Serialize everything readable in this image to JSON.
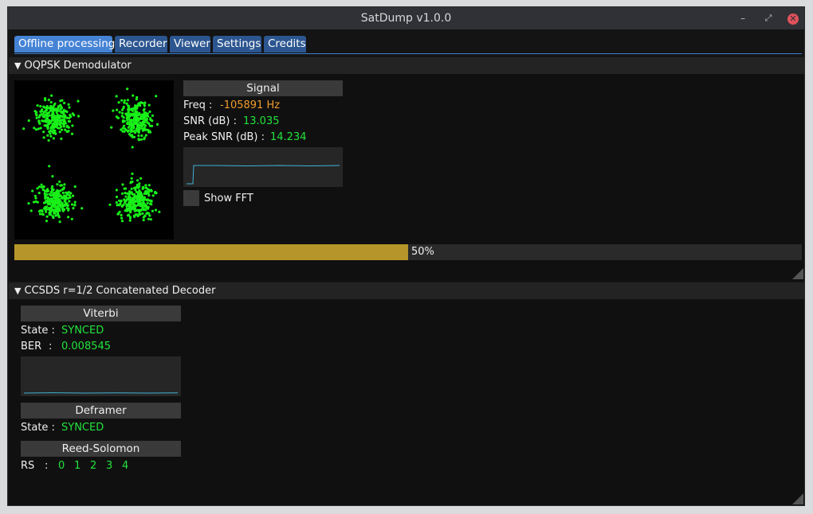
{
  "window": {
    "title": "SatDump v1.0.0",
    "min_glyph": "–",
    "max_glyph": "⤢",
    "close_glyph": "✕"
  },
  "tabs": [
    {
      "label": "Offline processing",
      "active": true
    },
    {
      "label": "Recorder",
      "active": false
    },
    {
      "label": "Viewer",
      "active": false
    },
    {
      "label": "Settings",
      "active": false
    },
    {
      "label": "Credits",
      "active": false
    }
  ],
  "demodulator": {
    "header": "OQPSK Demodulator",
    "collapse_arrow": "▼",
    "signal": {
      "title": "Signal",
      "freq_label": "Freq :",
      "freq_value": "-105891 Hz",
      "snr_label": "SNR (dB) :",
      "snr_value": "13.035",
      "peak_label": "Peak SNR (dB) :",
      "peak_value": "14.234",
      "show_fft_label": "Show FFT",
      "show_fft_checked": false
    },
    "progress": {
      "fraction": 0.5,
      "text": "50%"
    }
  },
  "decoder": {
    "header": "CCSDS r=1/2 Concatenated Decoder",
    "collapse_arrow": "▼",
    "viterbi": {
      "title": "Viterbi",
      "state_label": "State :",
      "state_value": "SYNCED",
      "ber_label": "BER",
      "ber_sep": ":",
      "ber_value": "0.008545"
    },
    "deframer": {
      "title": "Deframer",
      "state_label": "State :",
      "state_value": "SYNCED"
    },
    "reed_solomon": {
      "title": "Reed-Solomon",
      "rs_label": "RS",
      "rs_sep": ":",
      "values": [
        "0",
        "1",
        "2",
        "3",
        "4"
      ]
    }
  },
  "colors": {
    "accent": "#4583d5",
    "tab": "#2c5690",
    "green": "#22e33c",
    "orange": "#f09d2a",
    "progress": "#b6962a",
    "trace": "#3fb3d6"
  }
}
